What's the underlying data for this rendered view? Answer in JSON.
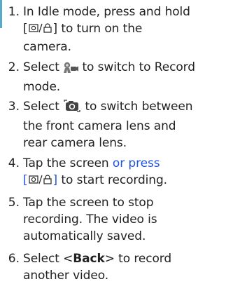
{
  "steps": [
    {
      "number": "1.",
      "line_a": "In Idle mode, press and hold",
      "key_open": "[",
      "key_close": "]",
      "tail": " to turn on the",
      "line_c": "camera."
    },
    {
      "number": "2.",
      "pre": "Select ",
      "post": " to switch to Record",
      "line_b": "mode.",
      "icon": "camcorder-mode-icon"
    },
    {
      "number": "3.",
      "pre": "Select ",
      "post": " to switch between",
      "line_b": "the front camera lens and",
      "line_c": "rear camera lens.",
      "icon": "switch-camera-icon"
    },
    {
      "number": "4.",
      "pre": "Tap the screen ",
      "link": "or press",
      "key_open": "[",
      "key_close": "]",
      "tail": " to start recording."
    },
    {
      "number": "5.",
      "line_a": "Tap the screen to stop",
      "line_b": "recording. The video is",
      "line_c": "automatically saved."
    },
    {
      "number": "6.",
      "pre": "Select <",
      "bold": "Back",
      "post": "> to record",
      "line_b": "another video."
    }
  ],
  "colors": {
    "text": "#222222",
    "link": "#2255dd",
    "edge_bar": "#5aa9c8"
  },
  "key_icon": "camera-lock-key-icon"
}
